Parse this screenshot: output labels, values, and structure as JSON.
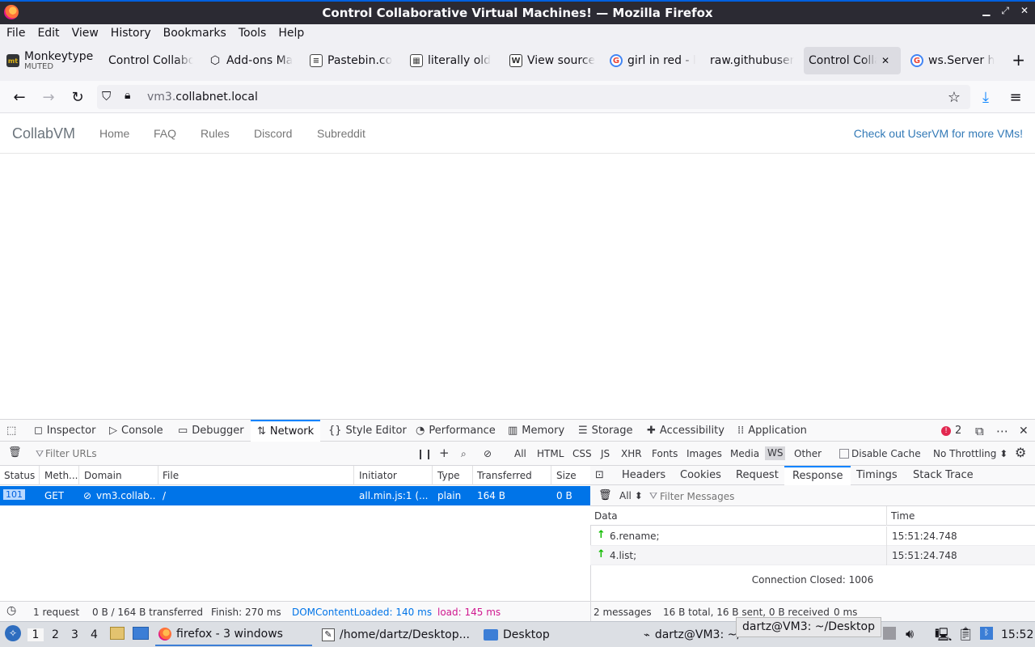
{
  "window": {
    "title": "Control Collaborative Virtual Machines! — Mozilla Firefox"
  },
  "menu": [
    "File",
    "Edit",
    "View",
    "History",
    "Bookmarks",
    "Tools",
    "Help"
  ],
  "tabs": [
    {
      "label": "Monkeytype",
      "sub": "MUTED",
      "icon": "monkeytype-icon"
    },
    {
      "label": "Control Collabo",
      "icon": "none"
    },
    {
      "label": "Add-ons Ma",
      "icon": "puzzle-icon"
    },
    {
      "label": "Pastebin.co",
      "icon": "pastebin-icon"
    },
    {
      "label": "literally old",
      "icon": "page-icon"
    },
    {
      "label": "View source",
      "icon": "wikipedia-icon"
    },
    {
      "label": "girl in red - l",
      "icon": "google-icon"
    },
    {
      "label": "raw.githubuser",
      "icon": "none"
    },
    {
      "label": "Control Colla",
      "icon": "none",
      "active": true
    },
    {
      "label": "ws.Server h",
      "icon": "google-icon"
    }
  ],
  "url": {
    "prefix": "vm3.",
    "host": "collabnet.local"
  },
  "page": {
    "brand": "CollabVM",
    "nav": [
      "Home",
      "FAQ",
      "Rules",
      "Discord",
      "Subreddit"
    ],
    "promo": "Check out UserVM for more VMs!"
  },
  "devtools": {
    "tabs": [
      "Inspector",
      "Console",
      "Debugger",
      "Network",
      "Style Editor",
      "Performance",
      "Memory",
      "Storage",
      "Accessibility",
      "Application"
    ],
    "error_count": "2",
    "filter_placeholder": "Filter URLs",
    "filter_types": [
      "All",
      "HTML",
      "CSS",
      "JS",
      "XHR",
      "Fonts",
      "Images",
      "Media",
      "WS",
      "Other"
    ],
    "disable_cache": "Disable Cache",
    "throttling": "No Throttling ⬍",
    "columns": [
      "Status",
      "Meth...",
      "Domain",
      "File",
      "Initiator",
      "Type",
      "Transferred",
      "Size"
    ],
    "request": {
      "status": "101",
      "method": "GET",
      "domain": "vm3.collab...",
      "file": "/",
      "initiator": "all.min.js:1 (...",
      "type": "plain",
      "transferred": "164 B",
      "size": "0 B"
    },
    "status": {
      "requests": "1 request",
      "transferred": "0 B / 164 B transferred",
      "finish": "Finish: 270 ms",
      "dcl": "DOMContentLoaded: 140 ms",
      "load": "load: 145 ms"
    },
    "side_tabs": [
      "Headers",
      "Cookies",
      "Request",
      "Response",
      "Timings",
      "Stack Trace"
    ],
    "msg_filter_select": "All ⬍",
    "msg_filter_placeholder": "Filter Messages",
    "msg_columns": [
      "Data",
      "Time"
    ],
    "messages": [
      {
        "data": "6.rename;",
        "time": "15:51:24.748"
      },
      {
        "data": "4.list;",
        "time": "15:51:24.748"
      }
    ],
    "connection_closed": "Connection Closed: 1006",
    "side_status": {
      "count": "2 messages",
      "bytes": "16 B total, 16 B sent, 0 B received",
      "time": "0 ms"
    }
  },
  "taskbar": {
    "workspaces": [
      "1",
      "2",
      "3",
      "4"
    ],
    "windows": [
      "firefox - 3 windows",
      "/home/dartz/Desktop...",
      "Desktop",
      "dartz@VM3: ~/"
    ],
    "tooltip": "dartz@VM3: ~/Desktop",
    "clock": "15:52"
  }
}
